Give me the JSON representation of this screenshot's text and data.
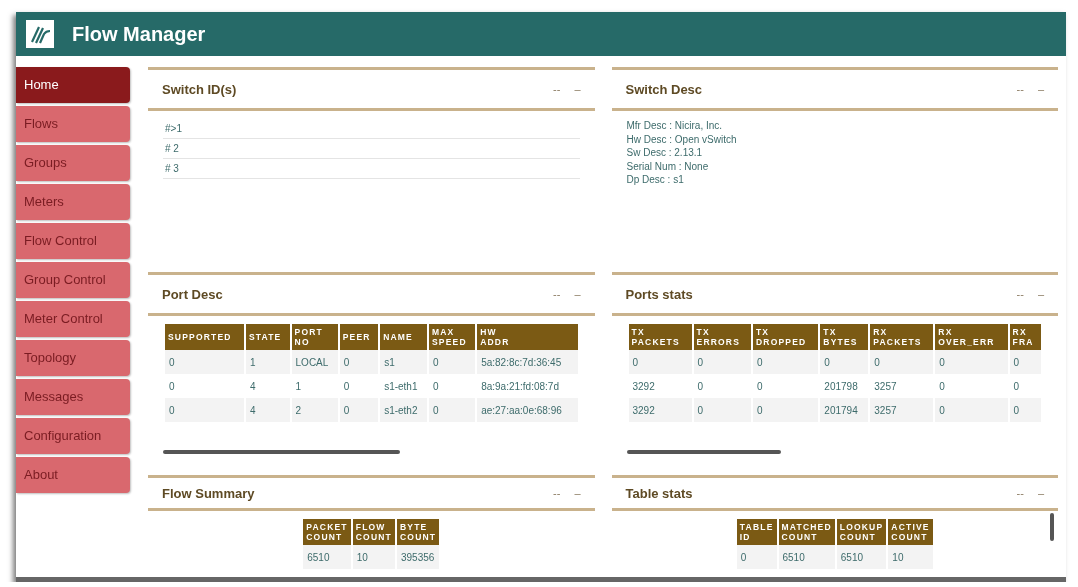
{
  "window": {
    "title": "Flow Manager"
  },
  "sidebar": {
    "items": [
      {
        "label": "Home",
        "selected": true
      },
      {
        "label": "Flows",
        "selected": false
      },
      {
        "label": "Groups",
        "selected": false
      },
      {
        "label": "Meters",
        "selected": false
      },
      {
        "label": "Flow Control",
        "selected": false
      },
      {
        "label": "Group Control",
        "selected": false
      },
      {
        "label": "Meter Control",
        "selected": false
      },
      {
        "label": "Topology",
        "selected": false
      },
      {
        "label": "Messages",
        "selected": false
      },
      {
        "label": "Configuration",
        "selected": false
      },
      {
        "label": "About",
        "selected": false
      }
    ]
  },
  "panels": [
    {
      "title": "Switch ID(s)",
      "controls": [
        "--",
        "–"
      ],
      "kind": "list",
      "items": [
        "#>1",
        "# 2",
        "# 3"
      ]
    },
    {
      "title": "Switch Desc",
      "controls": [
        "--",
        "–"
      ],
      "kind": "lines",
      "lines": [
        "Mfr Desc : Nicira, Inc.",
        "Hw Desc : Open vSwitch",
        "Sw Desc : 2.13.1",
        "Serial Num : None",
        "Dp Desc : s1"
      ]
    },
    {
      "title": "Port Desc",
      "controls": [
        "--",
        "–"
      ],
      "kind": "table",
      "columns": [
        "SUPPORTED",
        "STATE",
        "PORT\nNO",
        "PEER",
        "NAME",
        "MAX\nSPEED",
        "HW\nADDR"
      ],
      "rows": [
        [
          "0",
          "1",
          "LOCAL",
          "0",
          "s1",
          "0",
          "5a:82:8c:7d:36:45"
        ],
        [
          "0",
          "4",
          "1",
          "0",
          "s1-eth1",
          "0",
          "8a:9a:21:fd:08:7d"
        ],
        [
          "0",
          "4",
          "2",
          "0",
          "s1-eth2",
          "0",
          "ae:27:aa:0e:68:96"
        ]
      ]
    },
    {
      "title": "Ports stats",
      "controls": [
        "--",
        "–"
      ],
      "kind": "table",
      "columns": [
        "TX\nPACKETS",
        "TX\nERRORS",
        "TX\nDROPPED",
        "TX\nBYTES",
        "RX\nPACKETS",
        "RX\nOVER_ERR",
        "RX\nFRA"
      ],
      "rows": [
        [
          "0",
          "0",
          "0",
          "0",
          "0",
          "0",
          "0"
        ],
        [
          "3292",
          "0",
          "0",
          "201798",
          "3257",
          "0",
          "0"
        ],
        [
          "3292",
          "0",
          "0",
          "201794",
          "3257",
          "0",
          "0"
        ]
      ]
    },
    {
      "title": "Flow Summary",
      "controls": [
        "--",
        "–"
      ],
      "kind": "summary",
      "columns": [
        "PACKET\nCOUNT",
        "FLOW\nCOUNT",
        "BYTE\nCOUNT"
      ],
      "rows": [
        [
          "6510",
          "10",
          "395356"
        ]
      ]
    },
    {
      "title": "Table stats",
      "controls": [
        "--",
        "–"
      ],
      "kind": "overflowing",
      "columns": [
        "TABLE\nID",
        "MATCHED\nCOUNT",
        "LOOKUP\nCOUNT",
        "ACTIVE\nCOUNT"
      ],
      "rows": [
        [
          "0",
          "6510",
          "6510",
          "10"
        ]
      ]
    }
  ]
}
